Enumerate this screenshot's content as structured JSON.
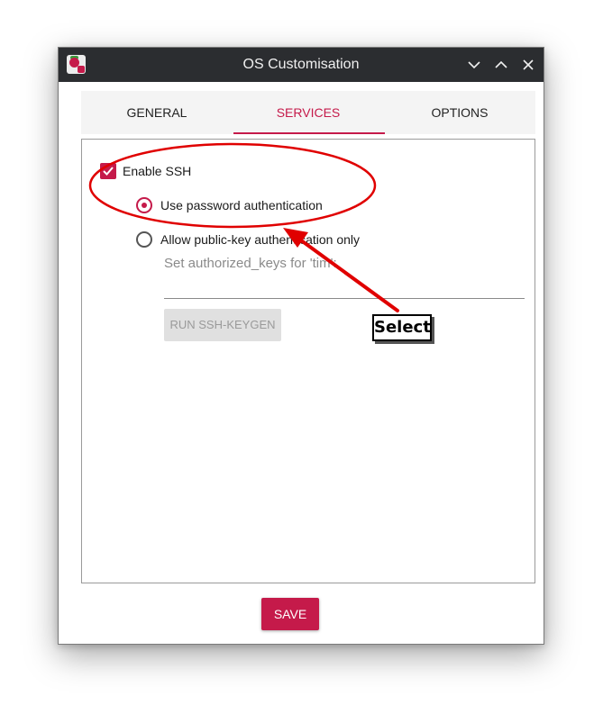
{
  "window": {
    "title": "OS Customisation",
    "controls": [
      "minimize",
      "maximize",
      "close"
    ]
  },
  "tabs": [
    {
      "label": "GENERAL",
      "active": false
    },
    {
      "label": "SERVICES",
      "active": true
    },
    {
      "label": "OPTIONS",
      "active": false
    }
  ],
  "services": {
    "enable_ssh": {
      "label": "Enable SSH",
      "checked": true
    },
    "auth_password": {
      "label": "Use password authentication",
      "selected": true
    },
    "auth_pubkey": {
      "label": "Allow public-key authentication only",
      "selected": false
    },
    "authorized_keys_label": "Set authorized_keys for 'tim':",
    "authorized_keys_value": "",
    "keygen_button": "RUN SSH-KEYGEN"
  },
  "footer": {
    "save_label": "SAVE"
  },
  "annotation": {
    "callout_text": "Select"
  },
  "colors": {
    "accent": "#c51a4a",
    "titlebar": "#2b2d30",
    "annotation": "#e00000"
  }
}
